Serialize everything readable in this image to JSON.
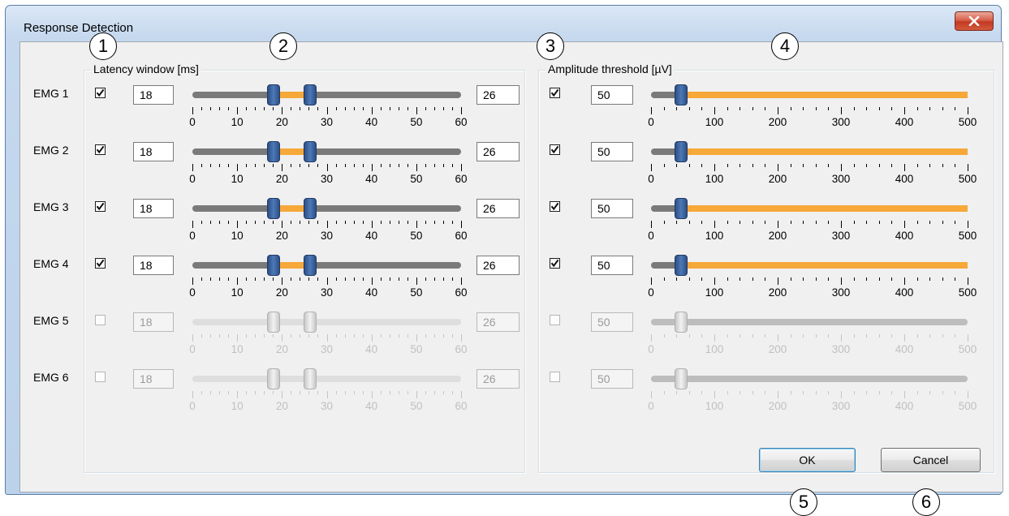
{
  "window": {
    "title": "Response Detection",
    "close_icon": "close-x-icon"
  },
  "callouts": [
    "1",
    "2",
    "3",
    "4",
    "5",
    "6"
  ],
  "latency_group": {
    "title": "Latency window [ms]",
    "scale_labels": [
      "0",
      "10",
      "20",
      "30",
      "40",
      "50",
      "60"
    ],
    "range": [
      0,
      60
    ]
  },
  "amplitude_group": {
    "title": "Amplitude threshold [µV]",
    "scale_labels": [
      "0",
      "100",
      "200",
      "300",
      "400",
      "500"
    ],
    "range": [
      0,
      500
    ]
  },
  "channels": [
    {
      "label": "EMG 1",
      "enabled": true,
      "lat_min": "18",
      "lat_max": "26",
      "amp_enabled": true,
      "amp": "50"
    },
    {
      "label": "EMG 2",
      "enabled": true,
      "lat_min": "18",
      "lat_max": "26",
      "amp_enabled": true,
      "amp": "50"
    },
    {
      "label": "EMG 3",
      "enabled": true,
      "lat_min": "18",
      "lat_max": "26",
      "amp_enabled": true,
      "amp": "50"
    },
    {
      "label": "EMG 4",
      "enabled": true,
      "lat_min": "18",
      "lat_max": "26",
      "amp_enabled": true,
      "amp": "50"
    },
    {
      "label": "EMG 5",
      "enabled": false,
      "lat_min": "18",
      "lat_max": "26",
      "amp_enabled": false,
      "amp": "50"
    },
    {
      "label": "EMG 6",
      "enabled": false,
      "lat_min": "18",
      "lat_max": "26",
      "amp_enabled": false,
      "amp": "50"
    }
  ],
  "buttons": {
    "ok": "OK",
    "cancel": "Cancel"
  },
  "colors": {
    "selected_range": "#f6a839",
    "thumb": "#3d659f",
    "track": "#7a7a7a"
  }
}
